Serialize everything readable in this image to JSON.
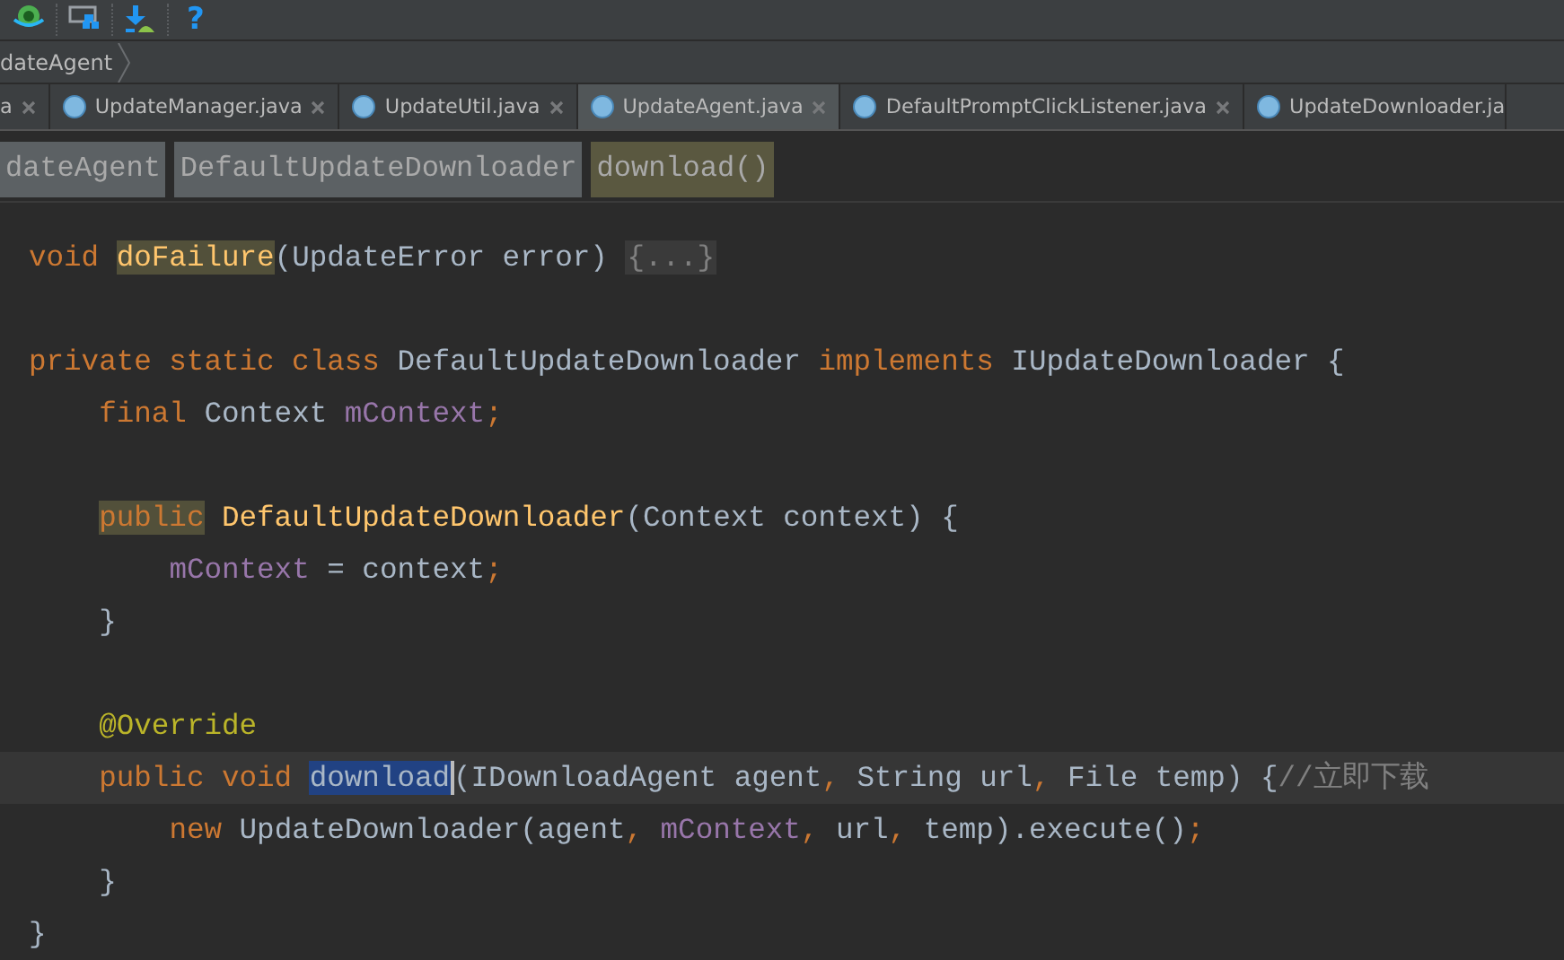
{
  "toolbar": {
    "items": [
      {
        "kind": "icon"
      },
      {
        "kind": "icon"
      },
      {
        "kind": "icon"
      },
      {
        "kind": "text",
        "text": "?"
      }
    ]
  },
  "navigation_bar": {
    "items": [
      "dateAgent"
    ]
  },
  "tabs": [
    {
      "label": "a",
      "selected": false,
      "kind": "head"
    },
    {
      "label": "UpdateManager.java",
      "selected": false,
      "kind": "full"
    },
    {
      "label": "UpdateUtil.java",
      "selected": false,
      "kind": "full"
    },
    {
      "label": "UpdateAgent.java",
      "selected": true,
      "kind": "full"
    },
    {
      "label": "DefaultPromptClickListener.java",
      "selected": false,
      "kind": "full"
    },
    {
      "label": "UpdateDownloader.ja",
      "selected": false,
      "kind": "tail"
    }
  ],
  "structure_breadcrumb": [
    {
      "label": "dateAgent",
      "selected": false
    },
    {
      "label": "DefaultUpdateDownloader",
      "selected": false
    },
    {
      "label": "download()",
      "selected": true
    }
  ],
  "editor": {
    "lines": [
      {
        "kind": "code",
        "tokens": [
          {
            "text": "void ",
            "kind": "keyword"
          },
          {
            "text": "doFailure",
            "kind": "usage"
          },
          {
            "text": "(UpdateError error) ",
            "kind": "plain"
          },
          {
            "text": "{...}",
            "kind": "fold"
          }
        ]
      },
      {
        "kind": "blank"
      },
      {
        "kind": "code",
        "tokens": [
          {
            "text": "private static class ",
            "kind": "keyword"
          },
          {
            "text": "DefaultUpdateDownloader ",
            "kind": "plain"
          },
          {
            "text": "implements ",
            "kind": "keyword"
          },
          {
            "text": "IUpdateDownloader {",
            "kind": "plain"
          }
        ],
        "children": [
          {
            "kind": "code",
            "tokens": [
              {
                "text": "final ",
                "kind": "keyword"
              },
              {
                "text": "Context ",
                "kind": "plain"
              },
              {
                "text": "mContext",
                "kind": "field"
              },
              {
                "text": ";",
                "kind": "keyword"
              }
            ]
          },
          {
            "kind": "blank"
          },
          {
            "kind": "code",
            "tokens": [
              {
                "text": "public",
                "kind": "usage-keyword"
              },
              {
                "text": " DefaultUpdateDownloader",
                "kind": "method"
              },
              {
                "text": "(Context context) {",
                "kind": "plain"
              }
            ],
            "children": [
              {
                "kind": "code",
                "tokens": [
                  {
                    "text": "mContext",
                    "kind": "field"
                  },
                  {
                    "text": " = context",
                    "kind": "plain"
                  },
                  {
                    "text": ";",
                    "kind": "keyword"
                  }
                ]
              }
            ]
          },
          {
            "kind": "code",
            "tokens": [
              {
                "text": "}",
                "kind": "plain"
              }
            ]
          },
          {
            "kind": "blank"
          },
          {
            "kind": "code",
            "tokens": [
              {
                "text": "@Override",
                "kind": "annotation"
              }
            ]
          },
          {
            "kind": "caret-line",
            "tokens": [
              {
                "text": "public void ",
                "kind": "keyword"
              },
              {
                "text": "download",
                "kind": "selected"
              },
              {
                "text": "(IDownloadAgent agent",
                "kind": "plain"
              },
              {
                "text": ", ",
                "kind": "keyword"
              },
              {
                "text": "String url",
                "kind": "plain"
              },
              {
                "text": ", ",
                "kind": "keyword"
              },
              {
                "text": "File temp) {",
                "kind": "plain"
              },
              {
                "text": "//立即下载",
                "kind": "comment"
              }
            ],
            "children": [
              {
                "kind": "code",
                "tokens": [
                  {
                    "text": "new ",
                    "kind": "keyword"
                  },
                  {
                    "text": "UpdateDownloader(agent",
                    "kind": "plain"
                  },
                  {
                    "text": ", ",
                    "kind": "keyword"
                  },
                  {
                    "text": "mContext",
                    "kind": "field"
                  },
                  {
                    "text": ", ",
                    "kind": "keyword"
                  },
                  {
                    "text": "url",
                    "kind": "plain"
                  },
                  {
                    "text": ", ",
                    "kind": "keyword"
                  },
                  {
                    "text": "temp).execute()",
                    "kind": "plain"
                  },
                  {
                    "text": ";",
                    "kind": "keyword"
                  }
                ]
              }
            ]
          },
          {
            "kind": "code",
            "tokens": [
              {
                "text": "}",
                "kind": "plain"
              }
            ]
          }
        ]
      },
      {
        "kind": "code",
        "tokens": [
          {
            "text": "}",
            "kind": "plain"
          }
        ]
      }
    ]
  }
}
